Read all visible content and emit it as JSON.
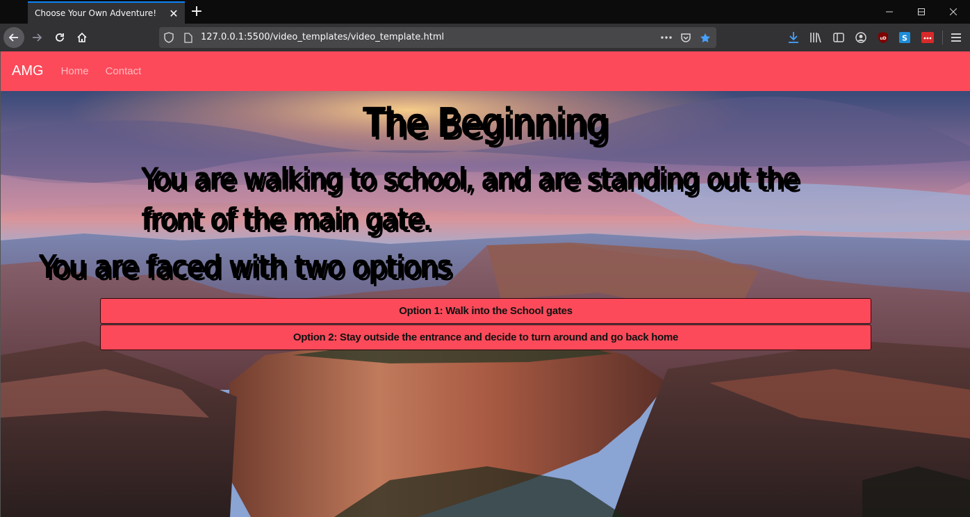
{
  "browser": {
    "tab_title": "Choose Your Own Adventure!",
    "url": "127.0.0.1:5500/video_templates/video_template.html",
    "icons": [
      "back-icon",
      "forward-icon",
      "reload-icon",
      "home-icon",
      "shield-icon",
      "page-icon",
      "more-icon",
      "pocket-icon",
      "bookmark-star-icon",
      "download-icon",
      "library-icon",
      "sidebar-icon",
      "account-icon",
      "ublock-icon",
      "extension-s-icon",
      "extension-dots-icon",
      "menu-icon"
    ],
    "accent": "#0a84ff"
  },
  "site": {
    "brand": "AMG",
    "nav": {
      "home": "Home",
      "contact": "Contact"
    },
    "brand_color": "#fc4a5a"
  },
  "story": {
    "title": "The Beginning",
    "text": "You are walking to school, and are standing out the front of the main gate.",
    "prompt": "You are faced with two options",
    "options": [
      "Option 1: Walk into the School gates",
      "Option 2: Stay outside the entrance and decide to turn around and go back home"
    ]
  }
}
